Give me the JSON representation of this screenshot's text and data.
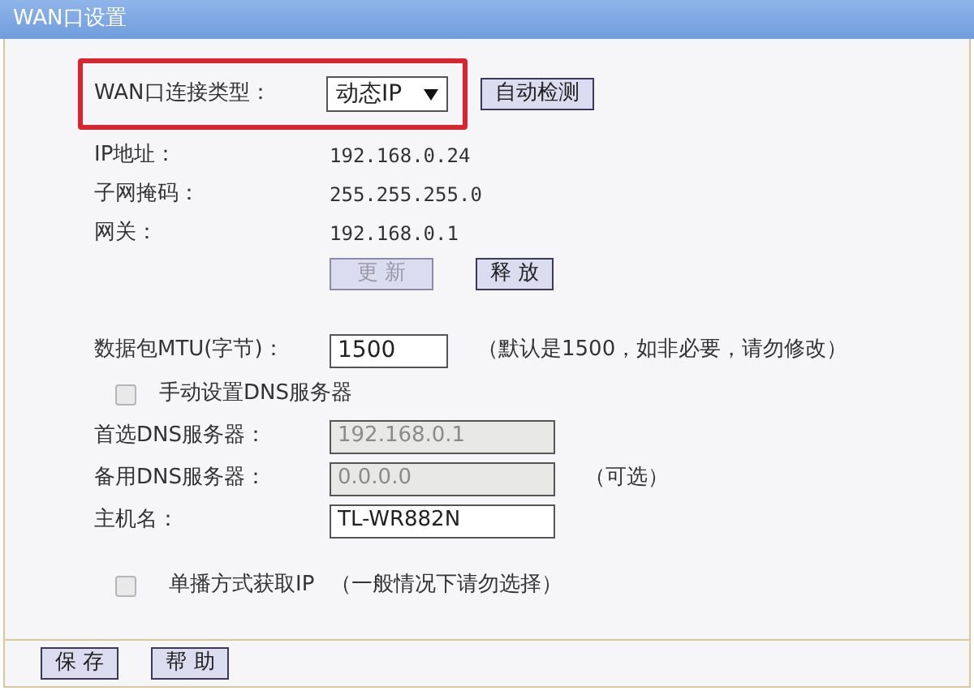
{
  "window": {
    "title": "WAN口设置"
  },
  "connection_type": {
    "label": "WAN口连接类型：",
    "value": "动态IP",
    "detect_button": "自动检测"
  },
  "status": [
    {
      "label": "IP地址：",
      "value": "192.168.0.24"
    },
    {
      "label": "子网掩码：",
      "value": "255.255.255.0"
    },
    {
      "label": "网关：",
      "value": "192.168.0.1"
    }
  ],
  "status_buttons": [
    {
      "label": "更 新",
      "disabled": true
    },
    {
      "label": "释 放",
      "disabled": false
    }
  ],
  "mtu": {
    "label": "数据包MTU(字节)：",
    "value": "1500",
    "note": "（默认是1500，如非必要，请勿修改）"
  },
  "manual_dns": {
    "label": "手动设置DNS服务器",
    "checked": false
  },
  "dns_fields": [
    {
      "label": "首选DNS服务器：",
      "value": "192.168.0.1",
      "disabled": true
    },
    {
      "label": "备用DNS服务器：",
      "value": "0.0.0.0",
      "disabled": true,
      "note": "（可选）"
    },
    {
      "label": "主机名：",
      "value": "TL-WR882N",
      "disabled": false
    }
  ],
  "unicast": {
    "label": "单播方式获取IP",
    "note": "（一般情况下请勿选择）",
    "checked": false
  },
  "footer_buttons": [
    "保 存",
    "帮 助"
  ]
}
